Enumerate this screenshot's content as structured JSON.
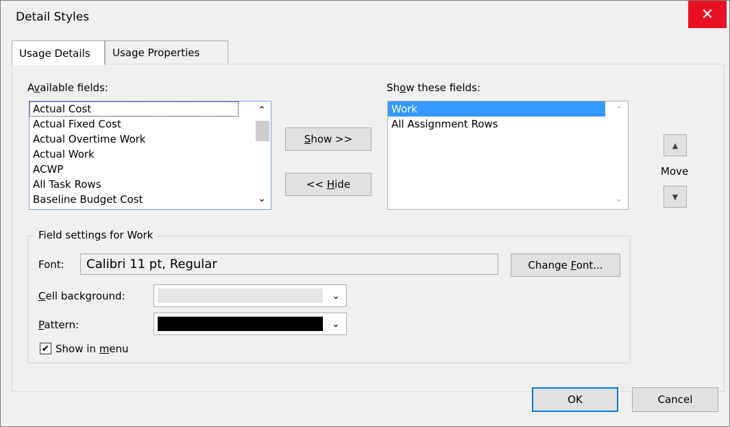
{
  "window": {
    "title": "Detail Styles",
    "close_icon": "✕"
  },
  "tabs": [
    {
      "label": "Usage Details",
      "active": true
    },
    {
      "label": "Usage Properties",
      "active": false
    }
  ],
  "available": {
    "label": "Available fields:",
    "items": [
      "Actual Cost",
      "Actual Fixed Cost",
      "Actual Overtime Work",
      "Actual Work",
      "ACWP",
      "All Task Rows",
      "Baseline Budget Cost"
    ]
  },
  "show_fields": {
    "label": "Show these fields:",
    "items": [
      "Work",
      "All Assignment Rows"
    ],
    "selected": "Work"
  },
  "buttons": {
    "show": "Show >>",
    "hide": "<< Hide",
    "move_label": "Move",
    "change_font": "Change Font...",
    "ok": "OK",
    "cancel": "Cancel"
  },
  "field_settings": {
    "group_label": "Field settings for Work",
    "font_label": "Font:",
    "font_value": "Calibri 11 pt, Regular",
    "cell_bg_label": "Cell background:",
    "cell_bg_color": "#e6e6e6",
    "pattern_label": "Pattern:",
    "pattern_color": "#000000",
    "show_in_menu_label": "Show in menu",
    "show_in_menu_checked": true
  },
  "icons": {
    "up": "▲",
    "down": "▼",
    "chevron_up": "⌃",
    "chevron_down": "⌄",
    "check": "✔"
  }
}
